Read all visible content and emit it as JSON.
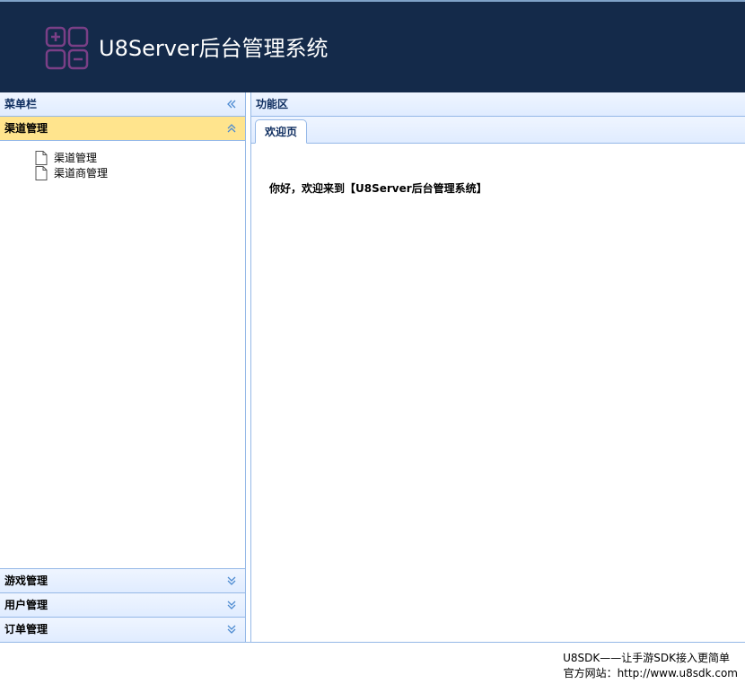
{
  "header": {
    "title": "U8Server后台管理系统",
    "logo_icon": "calculator-grid-icon",
    "background": "#142a4a"
  },
  "menu_panel": {
    "title": "菜单栏",
    "collapse_icon": "double-chevron-left-icon",
    "sections": [
      {
        "label": "渠道管理",
        "expanded": true,
        "items": [
          "渠道管理",
          "渠道商管理"
        ]
      },
      {
        "label": "游戏管理",
        "expanded": false
      },
      {
        "label": "用户管理",
        "expanded": false
      },
      {
        "label": "订单管理",
        "expanded": false
      }
    ],
    "selected_color": "#ffe48d"
  },
  "content_panel": {
    "title": "功能区",
    "tabs": [
      {
        "label": "欢迎页",
        "active": true
      }
    ],
    "welcome_text": "你好，欢迎来到【U8Server后台管理系统】"
  },
  "footer": {
    "slogan": "U8SDK——让手游SDK接入更简单",
    "website": "官方网站：http://www.u8sdk.com"
  }
}
